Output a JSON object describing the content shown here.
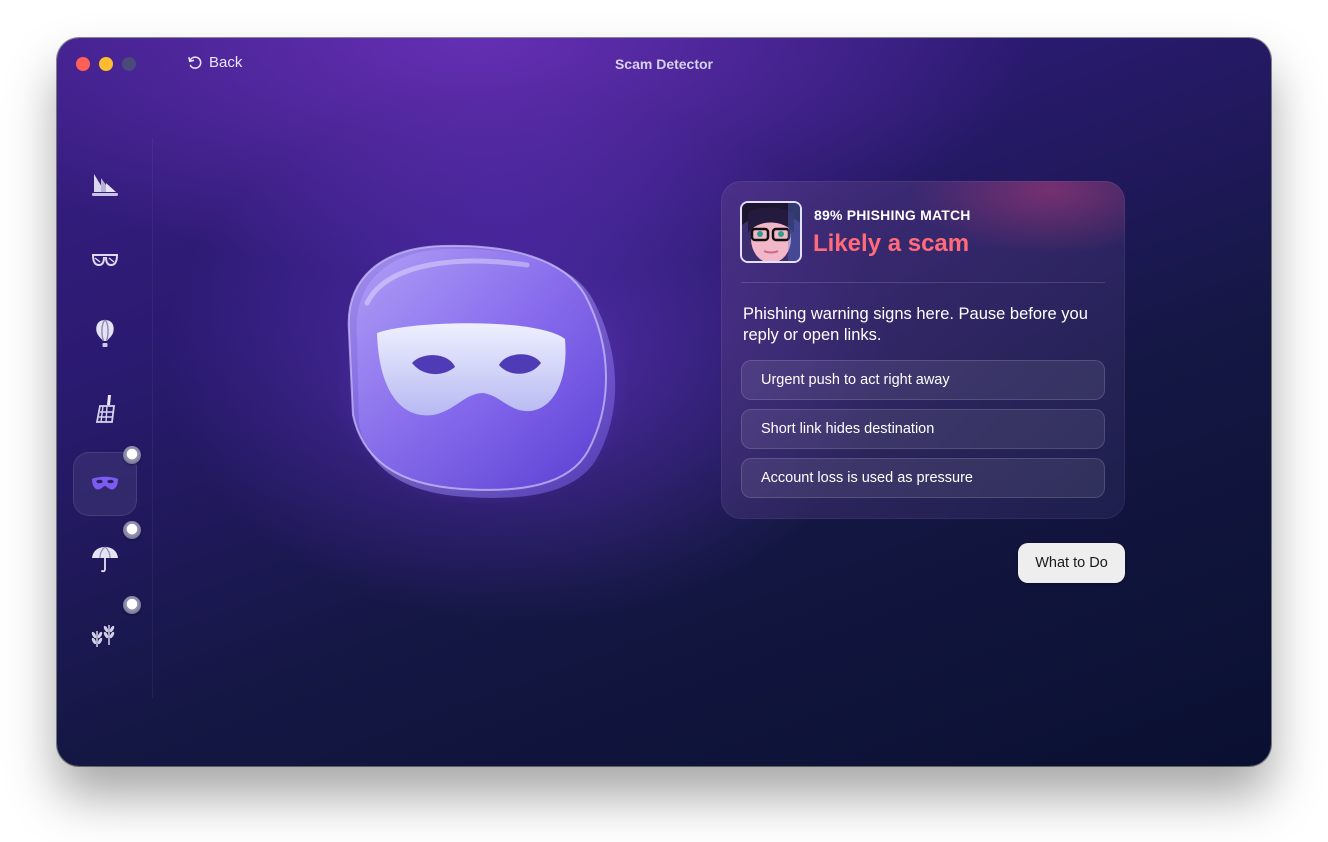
{
  "window": {
    "title": "Scam Detector"
  },
  "toolbar": {
    "back_label": "Back"
  },
  "sidebar": {
    "items": [
      {
        "icon": "sailboat-icon"
      },
      {
        "icon": "glasses-icon"
      },
      {
        "icon": "hot-air-balloon-icon"
      },
      {
        "icon": "paint-brush-icon"
      },
      {
        "icon": "mask-icon",
        "active": true,
        "badge": true
      },
      {
        "icon": "umbrella-icon",
        "badge": true
      },
      {
        "icon": "leaves-icon",
        "badge": true
      }
    ]
  },
  "result": {
    "match_label": "89% PHISHING MATCH",
    "verdict": "Likely a scam",
    "description": "Phishing warning signs here. Pause before you reply or open links.",
    "signs": [
      "Urgent push to act right away",
      "Short link hides destination",
      "Account loss is used as pressure"
    ]
  },
  "actions": {
    "what_to_do_label": "What to Do"
  },
  "colors": {
    "verdict": "#ff6b7a",
    "accent": "#6b4fe0"
  }
}
